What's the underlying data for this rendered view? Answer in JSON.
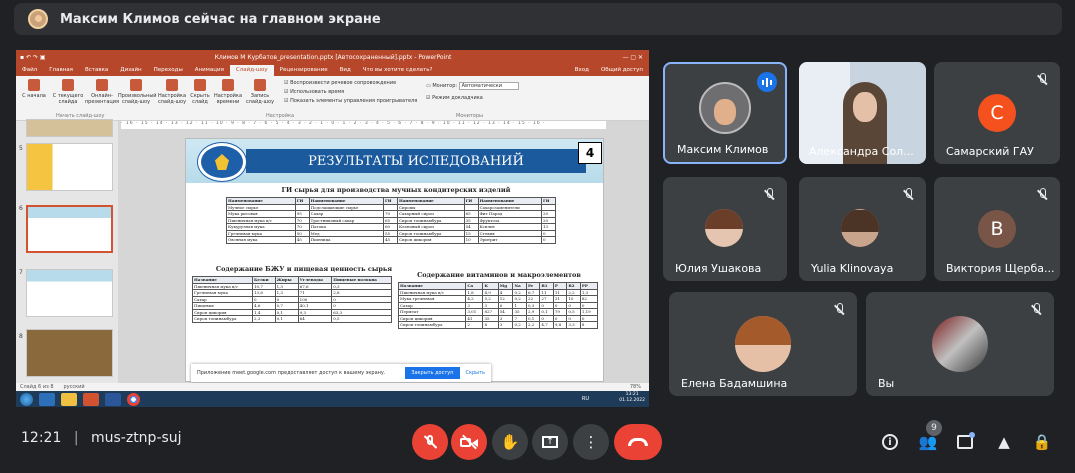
{
  "banner": {
    "text": "Максим Климов сейчас на главном экране"
  },
  "ppt": {
    "title": "Климов М Курбатов_presentation.pptx [Автосохраненный].pptx - PowerPoint",
    "tabs": [
      "Файл",
      "Главная",
      "Вставка",
      "Дизайн",
      "Переходы",
      "Анимация",
      "Слайд-шоу",
      "Рецензирование",
      "Вид",
      "Что вы хотите сделать?"
    ],
    "active_tab": "Слайд-шоу",
    "user": "Вход",
    "share": "Общий доступ",
    "ribbon": [
      "С начала",
      "С текущего слайда",
      "Онлайн-презентация",
      "Произвольный слайд-шоу",
      "Настройка слайд-шоу",
      "Скрыть слайд",
      "Настройка времени",
      "Запись слайд-шоу"
    ],
    "group1": "Начать слайд-шоу",
    "group2": "Настройка",
    "group3": "Мониторы",
    "checks": [
      "Воспроизвести речевое сопровождение",
      "Использовать время",
      "Показать элементы управления проигрывателя"
    ],
    "monitor_label": "Монитор:",
    "monitor_value": "Автоматически",
    "presenter": "Режим докладчика",
    "thumbs": [
      "5",
      "6",
      "7",
      "8"
    ],
    "ruler": "· 16 · 15 · 14 · 13 · 12 · 11 · 10 · 9 · 8 · 7 · 6 · 5 · 4 · 3 · 2 · 1 · 0 · 1 · 2 · 3 · 4 · 5 · 6 · 7 · 8 · 9 · 10 · 11 · 12 · 13 · 14 · 15 · 16 ·",
    "status_slide": "Слайд 6 из 8",
    "status_lang": "русский",
    "zoom": "78%",
    "clock_time": "13:21",
    "clock_date": "01.12.2022",
    "tray_lang": "RU"
  },
  "slide": {
    "title": "РЕЗУЛЬТАТЫ ИСЛЕДОВАНИЙ",
    "number": "4",
    "h1": "ГИ сырья для производства мучных кондитерских изделий",
    "h2": "Содержание БЖУ и пищевая ценность сырья",
    "h3": "Содержание витаминов и макроэлементов",
    "gi_table": [
      [
        "Наименование",
        "ГИ",
        "Наименование",
        "ГИ",
        "Наименование",
        "ГИ",
        "Наименование",
        "ГИ"
      ],
      [
        "Мучное сырье",
        "",
        "Подслащающие сырье",
        "",
        "Сиропы",
        "",
        "Сахарозаменители",
        ""
      ],
      [
        "Мука рисовая",
        "95",
        "Сахар",
        "70",
        "Сахарный сироп",
        "65",
        "Фит Парад",
        "20"
      ],
      [
        "Пшеничная мука в/с",
        "70",
        "Тростниковый сахар",
        "65",
        "Сироп топинамбура",
        "35",
        "Фруктоза",
        "20"
      ],
      [
        "Кукурузная мука",
        "70",
        "Патока",
        "60",
        "Кленовый сироп",
        "54",
        "Ксилит",
        "13"
      ],
      [
        "Гречневая мука",
        "50",
        "Мед",
        "55",
        "Сироп топинамбура",
        "15",
        "Стевия",
        "0"
      ],
      [
        "Овсяная мука",
        "45",
        "Пшеница",
        "45",
        "Сироп цикория",
        "10",
        "Эритрит",
        "0"
      ]
    ],
    "bju_table": [
      [
        "Название",
        "Белки",
        "Жиры",
        "Углеводы",
        "Пищевые волокна"
      ],
      [
        "Пшеничная мука в/с",
        "10,7",
        "1,3",
        "67,6",
        "0,3"
      ],
      [
        "Гречневая мука",
        "13,6",
        "1,3",
        "71",
        "2,8"
      ],
      [
        "Сахар",
        "0",
        "0",
        "100",
        "0"
      ],
      [
        "Пищевые",
        "4,6",
        "0,7",
        "40,1",
        "0"
      ],
      [
        "Сироп цикория",
        "1,4",
        "0,1",
        "9,3",
        "63,3"
      ],
      [
        "Сироп топинамбура",
        "2,3",
        "0,1",
        "64",
        "0,5"
      ]
    ],
    "vit_table": [
      [
        "Название",
        "Ca",
        "K",
        "Mg",
        "Na",
        "Fe",
        "B1",
        "P",
        "B2",
        "PP"
      ],
      [
        "Пшеничная мука в/с",
        "1,8",
        "4,9",
        "4",
        "0,2",
        "6,7",
        "11",
        "11",
        "2,2",
        "1,3"
      ],
      [
        "Мука гречневая",
        "4,2",
        "5,2",
        "12",
        "0,2",
        "22",
        "27",
        "31",
        "10",
        "82"
      ],
      [
        "Сахар",
        "3",
        "3",
        "0",
        "1",
        "0,3",
        "0",
        "0",
        "0",
        "0"
      ],
      [
        "Пермеат",
        "3,01",
        "827",
        "54",
        "35",
        "2,9",
        "0,1",
        "79",
        "0,5",
        "1,19"
      ],
      [
        "Сироп цикория",
        "41",
        "35",
        "3",
        "7",
        "0,1",
        "0",
        "0",
        "0",
        "0"
      ],
      [
        "Сироп топинамбура",
        "2",
        "8",
        "3",
        "0,2",
        "2,2",
        "4,7",
        "9,8",
        "3,3",
        "8"
      ]
    ]
  },
  "share_notice": {
    "text": "Приложение meet.google.com предоставляет доступ к вашему экрану.",
    "primary": "Закрыть доступ",
    "secondary": "Скрыть"
  },
  "participants": [
    {
      "name": "Максим Климов",
      "speaking": true
    },
    {
      "name": "Александра Сол..."
    },
    {
      "name": "Самарский ГАУ",
      "initial": "С",
      "color": "#f4511e"
    },
    {
      "name": "Юлия Ушакова"
    },
    {
      "name": "Yulia Klinovaya"
    },
    {
      "name": "Виктория Щерба...",
      "initial": "В",
      "color": "#795548"
    },
    {
      "name": "Елена Бадамшина"
    },
    {
      "name": "Вы"
    }
  ],
  "meeting": {
    "time": "12:21",
    "code": "mus-ztnp-suj",
    "people_count": "9"
  },
  "colors": {
    "end_call": "#ea4335",
    "muted": "#ea4335",
    "accent": "#8ab4f8",
    "bg": "#202124",
    "tile": "#3c4043"
  }
}
